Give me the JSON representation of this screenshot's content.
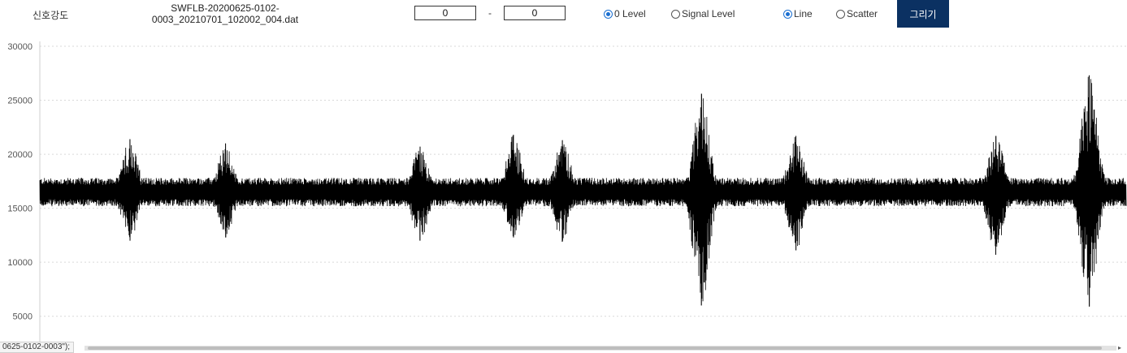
{
  "toolbar": {
    "signal_strength_label": "신호강도",
    "filename": "SWFLB-20200625-0102-0003_20210701_102002_004.dat",
    "range_from": "0",
    "range_separator": "-",
    "range_to": "0",
    "level_options": [
      "0 Level",
      "Signal Level"
    ],
    "level_selected": "0 Level",
    "style_options": [
      "Line",
      "Scatter"
    ],
    "style_selected": "Line",
    "draw_button": "그리기"
  },
  "colors": {
    "button_bg": "#0b3162",
    "radio_accent": "#1a6fd1",
    "signal_line": "#000000",
    "grid": "#d9d9d9"
  },
  "tooltip_fragment": "0625-0102-0003\");",
  "chart_data": {
    "type": "line",
    "title": "",
    "xlabel": "",
    "ylabel": "",
    "ylim": [
      2500,
      30000
    ],
    "yticks": [
      5000,
      10000,
      15000,
      20000,
      25000,
      30000
    ],
    "grid": "horizontal dotted",
    "baseline": 16500,
    "baseline_band": [
      15300,
      17700
    ],
    "x_range": [
      0,
      1
    ],
    "bursts": [
      {
        "x": 0.083,
        "max": 21400,
        "min": 12000
      },
      {
        "x": 0.171,
        "max": 21000,
        "min": 12300
      },
      {
        "x": 0.35,
        "max": 20700,
        "min": 12000
      },
      {
        "x": 0.436,
        "max": 21800,
        "min": 12300
      },
      {
        "x": 0.481,
        "max": 21300,
        "min": 11900
      },
      {
        "x": 0.609,
        "max": 25600,
        "min": 6000
      },
      {
        "x": 0.696,
        "max": 21700,
        "min": 11100
      },
      {
        "x": 0.88,
        "max": 21700,
        "min": 10700
      },
      {
        "x": 0.966,
        "max": 27300,
        "min": 5900
      }
    ]
  }
}
